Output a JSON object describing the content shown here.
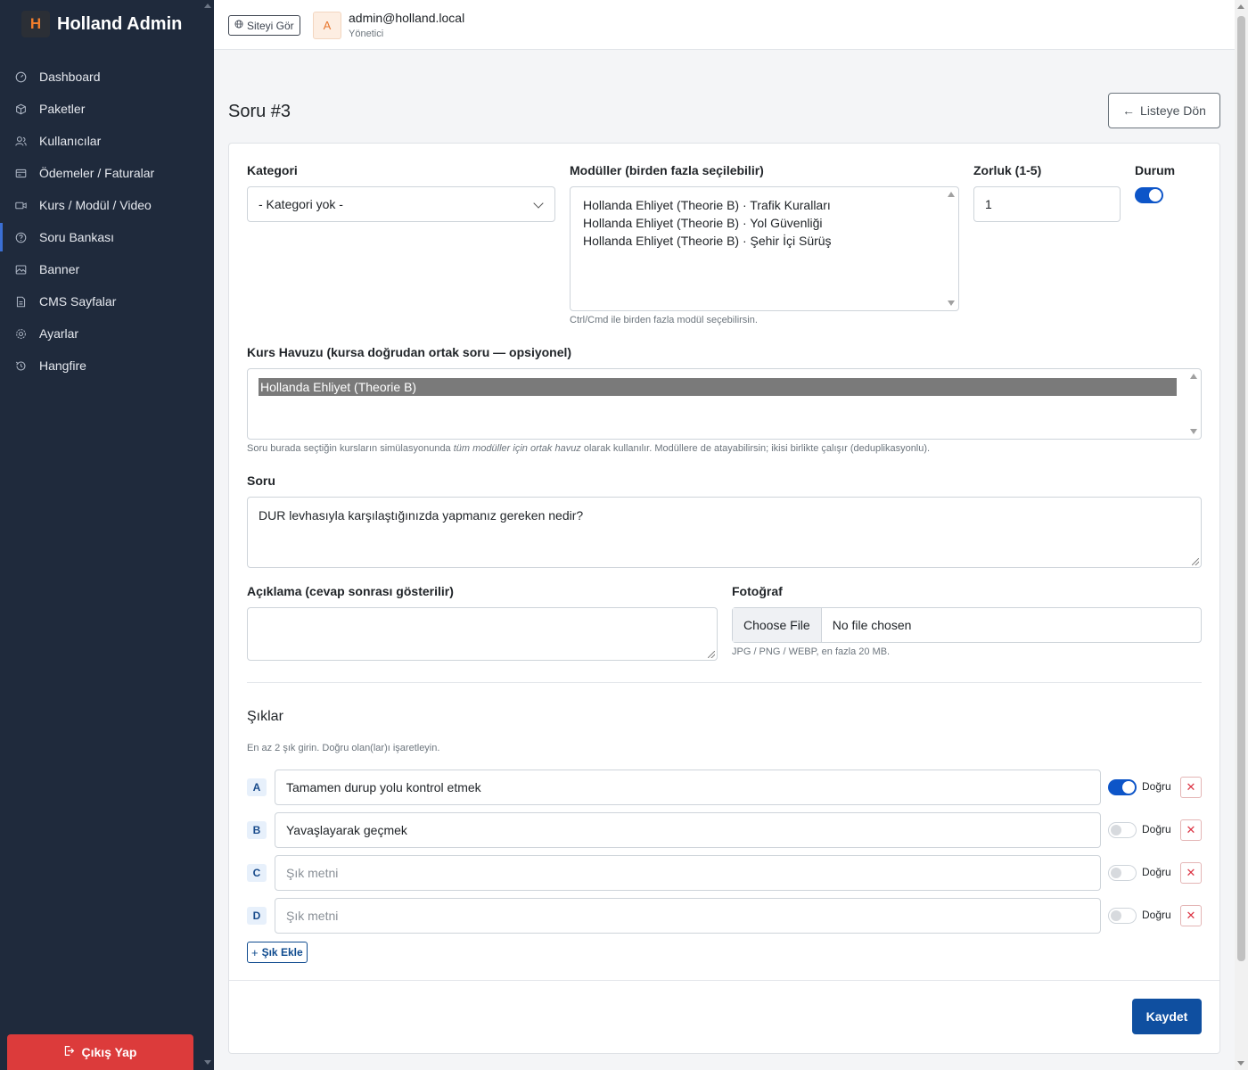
{
  "brand": {
    "logo_letter": "H",
    "name": "Holland Admin"
  },
  "sidebar": {
    "items": [
      {
        "label": "Dashboard",
        "icon": "gauge-icon"
      },
      {
        "label": "Paketler",
        "icon": "box-icon"
      },
      {
        "label": "Kullanıcılar",
        "icon": "users-icon"
      },
      {
        "label": "Ödemeler / Faturalar",
        "icon": "receipt-icon"
      },
      {
        "label": "Kurs / Modül / Video",
        "icon": "video-icon"
      },
      {
        "label": "Soru Bankası",
        "icon": "question-icon",
        "active": true
      },
      {
        "label": "Banner",
        "icon": "image-icon"
      },
      {
        "label": "CMS Sayfalar",
        "icon": "file-icon"
      },
      {
        "label": "Ayarlar",
        "icon": "gear-icon"
      },
      {
        "label": "Hangfire",
        "icon": "history-icon"
      }
    ],
    "logout_label": "Çıkış Yap"
  },
  "topbar": {
    "site_button": "Siteyi Gör",
    "avatar_letter": "A",
    "user_email": "admin@holland.local",
    "user_role": "Yönetici"
  },
  "page": {
    "title": "Soru #3",
    "back_button": "Listeye Dön"
  },
  "form": {
    "kategori": {
      "label": "Kategori",
      "value": "- Kategori yok -"
    },
    "moduller": {
      "label": "Modüller (birden fazla seçilebilir)",
      "options": [
        "Hollanda Ehliyet (Theorie B) · Trafik Kuralları",
        "Hollanda Ehliyet (Theorie B) · Yol Güvenliği",
        "Hollanda Ehliyet (Theorie B) · Şehir İçi Sürüş"
      ],
      "help": "Ctrl/Cmd ile birden fazla modül seçebilirsin."
    },
    "zorluk": {
      "label": "Zorluk (1-5)",
      "value": "1"
    },
    "durum": {
      "label": "Durum",
      "on": true
    },
    "kurs_havuzu": {
      "label": "Kurs Havuzu (kursa doğrudan ortak soru — opsiyonel)",
      "options": [
        "Hollanda Ehliyet (Theorie B)"
      ],
      "help_prefix": "Soru burada seçtiğin kursların simülasyonunda ",
      "help_emphasis": "tüm modüller için ortak havuz",
      "help_suffix": " olarak kullanılır. Modüllere de atayabilirsin; ikisi birlikte çalışır (deduplikasyonlu)."
    },
    "soru": {
      "label": "Soru",
      "value": "DUR levhasıyla karşılaştığınızda yapmanız gereken nedir?"
    },
    "aciklama": {
      "label": "Açıklama (cevap sonrası gösterilir)",
      "value": ""
    },
    "fotograf": {
      "label": "Fotoğraf",
      "button": "Choose File",
      "status": "No file chosen",
      "help": "JPG / PNG / WEBP, en fazla 20 MB."
    }
  },
  "choices": {
    "title": "Şıklar",
    "help": "En az 2 şık girin. Doğru olan(lar)ı işaretleyin.",
    "correct_label": "Doğru",
    "placeholder": "Şık metni",
    "items": [
      {
        "letter": "A",
        "text": "Tamamen durup yolu kontrol etmek",
        "correct": true
      },
      {
        "letter": "B",
        "text": "Yavaşlayarak geçmek",
        "correct": false
      },
      {
        "letter": "C",
        "text": "",
        "correct": false
      },
      {
        "letter": "D",
        "text": "",
        "correct": false
      }
    ],
    "add_button": "Şık Ekle"
  },
  "save_button": "Kaydet",
  "colors": {
    "sidebar": "#1f2a3c",
    "primary": "#0f4fa0",
    "danger": "#dc3b3b",
    "brand_accent": "#f07d2c"
  }
}
